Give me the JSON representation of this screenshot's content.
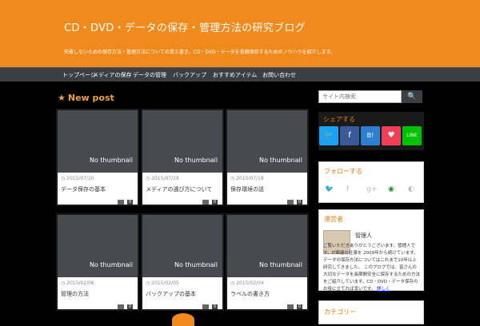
{
  "header": {
    "title": "CD・DVD・データの保存・管理方法の研究ブログ",
    "description": "失敗しないための保存方法・管理方法についての覚え書き。CD・DVD・データを長期保存するためのノウハウを紹介します。"
  },
  "nav": [
    "トップページ",
    "メディアの保存",
    "データの管理",
    "バックアップ",
    "おすすめアイテム",
    "お問い合わせ"
  ],
  "section_title": "New post",
  "posts": [
    {
      "thumb": "No thumbnail",
      "date": "2015/07/20",
      "title": "データ保存の基本",
      "count": "0"
    },
    {
      "thumb": "No thumbnail",
      "date": "2015/07/19",
      "title": "メディアの選び方について",
      "count": "0"
    },
    {
      "thumb": "No thumbnail",
      "date": "2015/07/18",
      "title": "保存環境の話",
      "count": "0"
    },
    {
      "thumb": "No thumbnail",
      "date": "2015/02/06",
      "title": "管理の方法",
      "count": "0"
    },
    {
      "thumb": "No thumbnail",
      "date": "2015/02/05",
      "title": "バックアップの基本",
      "count": "0"
    },
    {
      "thumb": "No thumbnail",
      "date": "2015/02/04",
      "title": "ラベルの書き方",
      "count": "0"
    }
  ],
  "sidebar": {
    "search_placeholder": "サイト内検索",
    "search_button": "🔍",
    "share_title": "シェアする",
    "share_buttons": [
      {
        "icon": "twitter",
        "glyph": "🐦",
        "color": "#1da1f2"
      },
      {
        "icon": "facebook",
        "glyph": "f",
        "color": "#3b5998"
      },
      {
        "icon": "hatena",
        "glyph": "B!",
        "color": "#2c7fd1"
      },
      {
        "icon": "pocket",
        "glyph": "♥",
        "color": "#ef3f56"
      },
      {
        "icon": "line",
        "glyph": "LINE",
        "color": "#00c300"
      }
    ],
    "follow_title": "フォローする",
    "follow_icons": [
      {
        "icon": "twitter",
        "glyph": "🐦"
      },
      {
        "icon": "facebook",
        "glyph": "f"
      },
      {
        "icon": "google-plus",
        "glyph": "g+"
      },
      {
        "icon": "rss",
        "glyph": "◉"
      },
      {
        "icon": "feedly",
        "glyph": "◐"
      }
    ],
    "profile_title": "運営者",
    "profile_name": "管理人",
    "profile_text": "ご覧いただきありがとうございます。管理人です。IT関連の仕事を 2009年から続けています。データの保存方法についてはこれまで10年以上研究してきました。 このブログでは、皆さんの大切なデータを長期間安全に保存するための方法をご紹介しています。CD・DVD・データ保存のお役に立てれば幸いです。",
    "profile_more": "詳しく",
    "last_widget_title": "カテゴリー"
  }
}
